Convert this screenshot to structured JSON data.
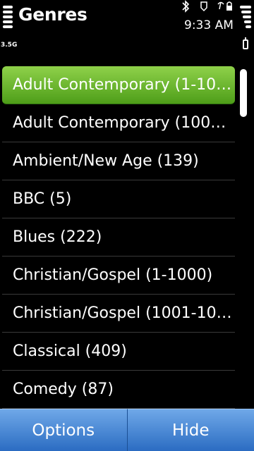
{
  "header": {
    "title": "Genres",
    "time": "9:33 AM",
    "network": "3.5G"
  },
  "list": {
    "items": [
      {
        "label": "Adult Contemporary (1-10…",
        "selected": true
      },
      {
        "label": "Adult Contemporary (100…"
      },
      {
        "label": "Ambient/New Age (139)"
      },
      {
        "label": "BBC (5)"
      },
      {
        "label": "Blues (222)"
      },
      {
        "label": "Christian/Gospel (1-1000)"
      },
      {
        "label": "Christian/Gospel (1001-10…"
      },
      {
        "label": "Classical (409)"
      },
      {
        "label": "Comedy (87)"
      }
    ]
  },
  "softkeys": {
    "left": "Options",
    "right": "Hide"
  },
  "colors": {
    "selection": "#6ab82e",
    "softkey": "#3e7fd6"
  }
}
